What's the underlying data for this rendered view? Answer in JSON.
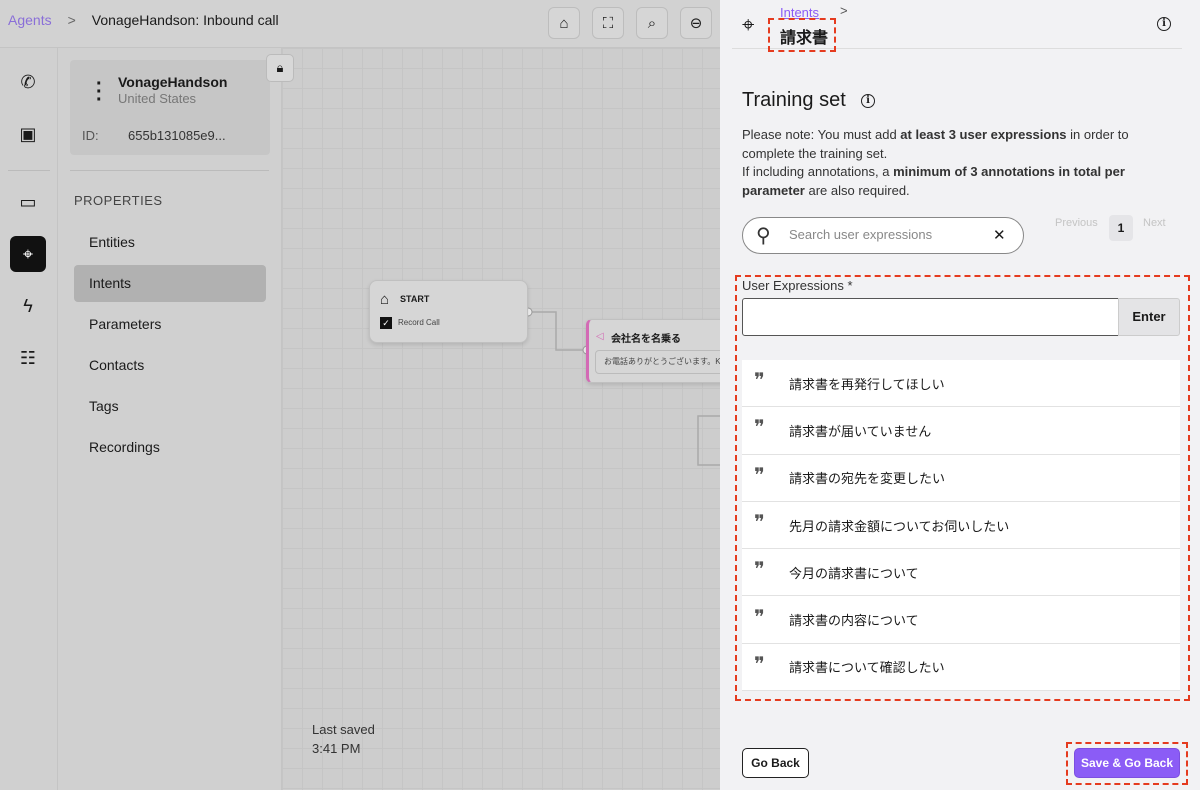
{
  "topbar": {
    "breadcrumb_root": "Agents",
    "breadcrumb_sep": ">",
    "breadcrumb_current": "VonageHandson: Inbound call"
  },
  "agent": {
    "name": "VonageHandson",
    "country": "United States",
    "id_label": "ID:",
    "id_value": "655b131085e9..."
  },
  "sidebar": {
    "heading": "PROPERTIES",
    "items": [
      {
        "label": "Entities"
      },
      {
        "label": "Intents"
      },
      {
        "label": "Parameters"
      },
      {
        "label": "Contacts"
      },
      {
        "label": "Tags"
      },
      {
        "label": "Recordings"
      }
    ],
    "active": "Intents"
  },
  "canvas": {
    "start_title": "START",
    "record_call": "Record Call",
    "node_title": "会社名を名乗る",
    "node_text": "お電話ありがとうございます。K...",
    "last_saved_label": "Last saved",
    "last_saved_time": "3:41 PM"
  },
  "panel": {
    "breadcrumb": "Intents",
    "breadcrumb_sep": ">",
    "title": "請求書",
    "training_title": "Training set",
    "note1a": "Please note: You must add ",
    "note1b": "at least 3 user expressions",
    "note1c": " in order to complete the training set.",
    "note2a": "If including annotations, a ",
    "note2b": "minimum of 3 annotations in total per parameter",
    "note2c": " are also required.",
    "search_placeholder": "Search user expressions",
    "prev": "Previous",
    "page": "1",
    "next": "Next",
    "ue_label": "User Expressions *",
    "ue_value": "",
    "enter": "Enter",
    "expressions": [
      "請求書を再発行してほしい",
      "請求書が届いていません",
      "請求書の宛先を変更したい",
      "先月の請求金額についてお伺いしたい",
      "今月の請求書について",
      "請求書の内容について",
      "請求書について確認したい"
    ],
    "go_back": "Go Back",
    "save_go_back": "Save & Go Back"
  },
  "colors": {
    "accent": "#8b5cf6",
    "annotation": "#e53b1f"
  }
}
